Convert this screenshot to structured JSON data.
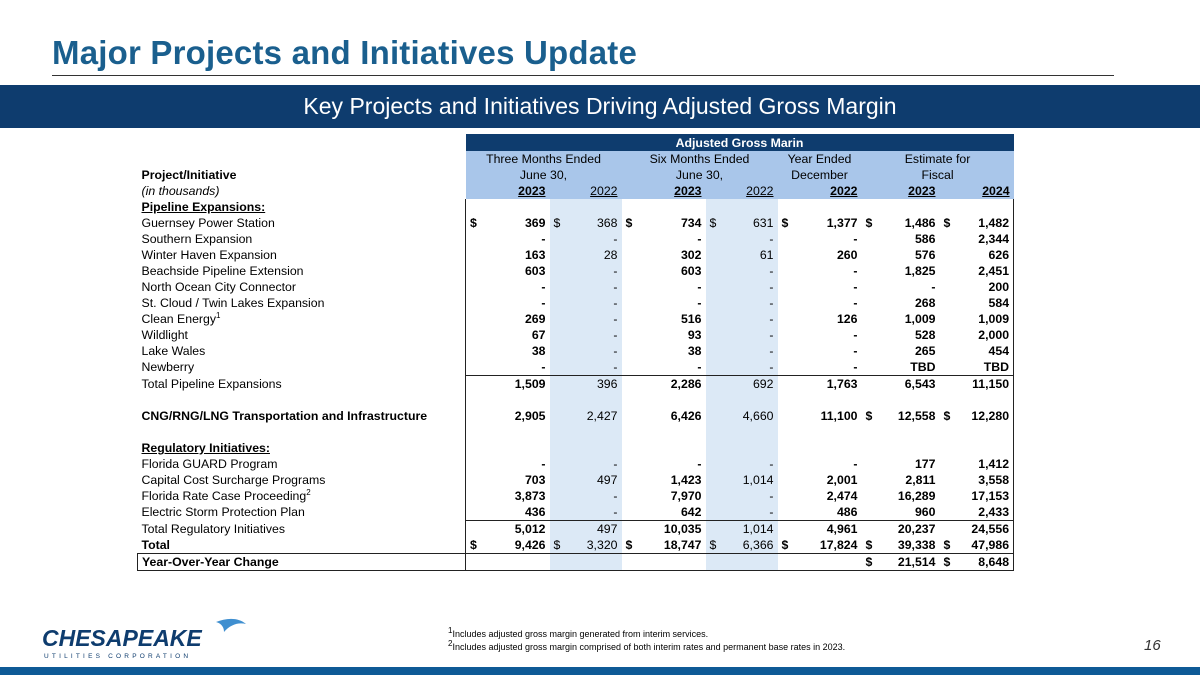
{
  "title": "Major Projects and Initiatives Update",
  "banner": "Key Projects and Initiatives Driving Adjusted Gross Margin",
  "table": {
    "group_header": "Adjusted Gross Marin",
    "label_header": "Project/Initiative",
    "label_sub": "(in thousands)",
    "col_groups": [
      {
        "line1": "Three Months Ended",
        "line2": "June 30,"
      },
      {
        "line1": "Six Months Ended",
        "line2": "June 30,"
      },
      {
        "line1": "Year Ended",
        "line2": "December"
      },
      {
        "line1": "Estimate for",
        "line2": "Fiscal"
      }
    ],
    "years": [
      "2023",
      "2022",
      "2023",
      "2022",
      "2022",
      "2023",
      "2024"
    ],
    "sections": {
      "pipeline": "Pipeline Expansions:",
      "regulatory": "Regulatory Initiatives:"
    },
    "pipeline_rows": [
      {
        "label": "Guernsey Power Station",
        "sup": "",
        "v": [
          "369",
          "368",
          "734",
          "631",
          "1,377",
          "1,486",
          "1,482"
        ]
      },
      {
        "label": "Southern Expansion",
        "sup": "",
        "v": [
          "-",
          "-",
          "-",
          "-",
          "-",
          "586",
          "2,344"
        ]
      },
      {
        "label": "Winter Haven Expansion",
        "sup": "",
        "v": [
          "163",
          "28",
          "302",
          "61",
          "260",
          "576",
          "626"
        ]
      },
      {
        "label": "Beachside Pipeline Extension",
        "sup": "",
        "v": [
          "603",
          "-",
          "603",
          "-",
          "-",
          "1,825",
          "2,451"
        ]
      },
      {
        "label": "North Ocean City Connector",
        "sup": "",
        "v": [
          "-",
          "-",
          "-",
          "-",
          "-",
          "-",
          "200"
        ]
      },
      {
        "label": "St. Cloud / Twin Lakes Expansion",
        "sup": "",
        "v": [
          "-",
          "-",
          "-",
          "-",
          "-",
          "268",
          "584"
        ]
      },
      {
        "label": "Clean Energy",
        "sup": "1",
        "v": [
          "269",
          "-",
          "516",
          "-",
          "126",
          "1,009",
          "1,009"
        ]
      },
      {
        "label": "Wildlight",
        "sup": "",
        "v": [
          "67",
          "-",
          "93",
          "-",
          "-",
          "528",
          "2,000"
        ]
      },
      {
        "label": "Lake Wales",
        "sup": "",
        "v": [
          "38",
          "-",
          "38",
          "-",
          "-",
          "265",
          "454"
        ]
      },
      {
        "label": "Newberry",
        "sup": "",
        "v": [
          "-",
          "-",
          "-",
          "-",
          "-",
          "TBD",
          "TBD"
        ]
      }
    ],
    "pipeline_total": {
      "label": "Total Pipeline Expansions",
      "v": [
        "1,509",
        "396",
        "2,286",
        "692",
        "1,763",
        "6,543",
        "11,150"
      ]
    },
    "cng": {
      "label": "CNG/RNG/LNG Transportation and Infrastructure",
      "v": [
        "2,905",
        "2,427",
        "6,426",
        "4,660",
        "11,100",
        "12,558",
        "12,280"
      ]
    },
    "regulatory_rows": [
      {
        "label": "Florida GUARD Program",
        "sup": "",
        "v": [
          "-",
          "-",
          "-",
          "-",
          "-",
          "177",
          "1,412"
        ]
      },
      {
        "label": "Capital Cost Surcharge Programs",
        "sup": "",
        "v": [
          "703",
          "497",
          "1,423",
          "1,014",
          "2,001",
          "2,811",
          "3,558"
        ]
      },
      {
        "label": "Florida Rate Case Proceeding",
        "sup": "2",
        "v": [
          "3,873",
          "-",
          "7,970",
          "-",
          "2,474",
          "16,289",
          "17,153"
        ]
      },
      {
        "label": "Electric Storm Protection Plan",
        "sup": "",
        "v": [
          "436",
          "-",
          "642",
          "-",
          "486",
          "960",
          "2,433"
        ]
      }
    ],
    "regulatory_total": {
      "label": "Total Regulatory Initiatives",
      "v": [
        "5,012",
        "497",
        "10,035",
        "1,014",
        "4,961",
        "20,237",
        "24,556"
      ]
    },
    "total": {
      "label": "Total",
      "v": [
        "9,426",
        "3,320",
        "18,747",
        "6,366",
        "17,824",
        "39,338",
        "47,986"
      ]
    },
    "yoy": {
      "label": "Year-Over-Year Change",
      "v": [
        "",
        "",
        "",
        "",
        "",
        "21,514",
        "8,648"
      ]
    },
    "dollar": "$"
  },
  "footnotes": [
    "Includes adjusted gross margin generated from interim services.",
    "Includes adjusted gross margin comprised of both interim rates and permanent base rates in 2023."
  ],
  "footnote_marks": [
    "1",
    "2"
  ],
  "logo": {
    "name": "CHESAPEAKE",
    "sub": "UTILITIES CORPORATION"
  },
  "page_number": "16",
  "colors": {
    "title": "#1a5f8e",
    "banner": "#0e3c6e",
    "header": "#a9c6ea",
    "shade": "#dce9f6"
  }
}
